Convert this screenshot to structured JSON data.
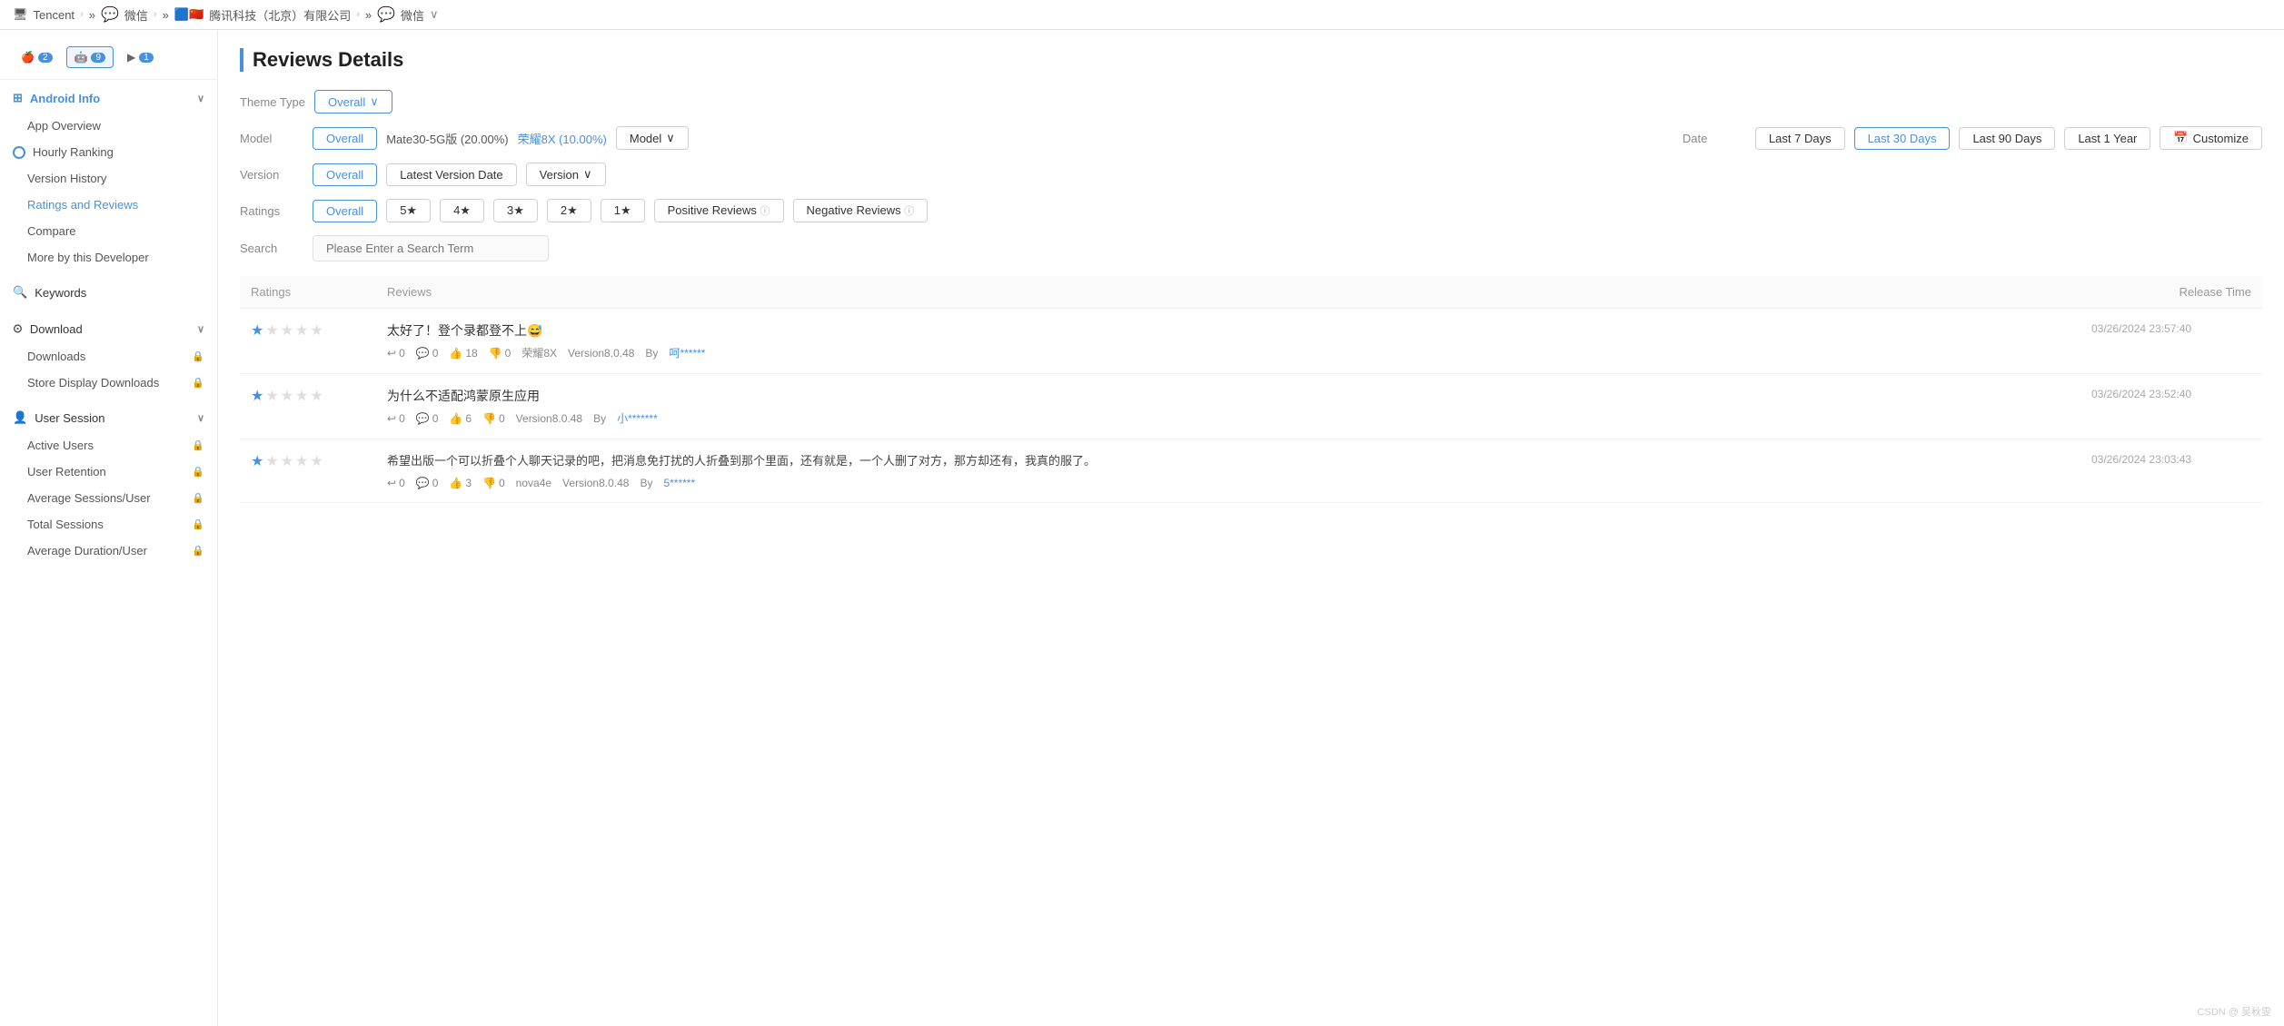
{
  "topbar": {
    "company": "Tencent",
    "app1": "微信",
    "app2": "腾讯科技（北京）有限公司",
    "app3": "微信",
    "chevron": "›",
    "separator": "»"
  },
  "platform_tabs": [
    {
      "id": "ios",
      "icon": "🍎",
      "badge": "2"
    },
    {
      "id": "android",
      "icon": "🤖",
      "badge": "9",
      "active": true
    },
    {
      "id": "play",
      "icon": "▶",
      "badge": "1"
    }
  ],
  "sidebar": {
    "android_info": {
      "label": "Android Info",
      "items": [
        {
          "id": "app-overview",
          "label": "App Overview"
        },
        {
          "id": "hourly-ranking",
          "label": "Hourly Ranking"
        },
        {
          "id": "version-history",
          "label": "Version History"
        },
        {
          "id": "ratings-reviews",
          "label": "Ratings and Reviews",
          "active": true
        },
        {
          "id": "compare",
          "label": "Compare"
        },
        {
          "id": "more-by-developer",
          "label": "More by this Developer"
        }
      ]
    },
    "keywords": {
      "label": "Keywords"
    },
    "download": {
      "label": "Download",
      "items": [
        {
          "id": "downloads",
          "label": "Downloads",
          "lock": true
        },
        {
          "id": "store-display-downloads",
          "label": "Store Display Downloads",
          "lock": true
        }
      ]
    },
    "user_session": {
      "label": "User Session",
      "items": [
        {
          "id": "active-users",
          "label": "Active Users",
          "lock": true
        },
        {
          "id": "user-retention",
          "label": "User Retention",
          "lock": true
        },
        {
          "id": "avg-sessions",
          "label": "Average Sessions/User",
          "lock": true
        },
        {
          "id": "total-sessions",
          "label": "Total Sessions",
          "lock": true
        },
        {
          "id": "avg-duration",
          "label": "Average Duration/User",
          "lock": true
        }
      ]
    }
  },
  "page": {
    "title": "Reviews Details",
    "theme_type_label": "Theme Type",
    "theme_type_value": "Overall",
    "filters": {
      "model_label": "Model",
      "model_options": [
        {
          "id": "overall",
          "label": "Overall",
          "active": true
        },
        {
          "id": "mate30",
          "label": "Mate30-5G版 (20.00%)"
        },
        {
          "id": "huawei8x",
          "label": "荣耀8X (10.00%)",
          "highlighted": true
        }
      ],
      "model_dropdown_label": "Model",
      "date_label": "Date",
      "date_options": [
        {
          "id": "7days",
          "label": "Last 7 Days"
        },
        {
          "id": "30days",
          "label": "Last 30 Days",
          "active": true
        },
        {
          "id": "90days",
          "label": "Last 90 Days"
        },
        {
          "id": "1year",
          "label": "Last 1 Year"
        },
        {
          "id": "customize",
          "label": "Customize"
        }
      ],
      "version_label": "Version",
      "version_options": [
        {
          "id": "overall",
          "label": "Overall",
          "active": true
        },
        {
          "id": "latest",
          "label": "Latest Version Date"
        }
      ],
      "version_dropdown_label": "Version",
      "ratings_label": "Ratings",
      "ratings_options": [
        {
          "id": "overall",
          "label": "Overall",
          "active": true
        },
        {
          "id": "5star",
          "label": "5★"
        },
        {
          "id": "4star",
          "label": "4★"
        },
        {
          "id": "3star",
          "label": "3★"
        },
        {
          "id": "2star",
          "label": "2★"
        },
        {
          "id": "1star",
          "label": "1★"
        },
        {
          "id": "positive",
          "label": "Positive Reviews"
        },
        {
          "id": "negative",
          "label": "Negative Reviews"
        }
      ]
    },
    "search_label": "Search",
    "search_placeholder": "Please Enter a Search Term",
    "table": {
      "columns": [
        "Ratings",
        "Reviews",
        "Release Time"
      ],
      "rows": [
        {
          "stars": 1,
          "total_stars": 5,
          "review_title": "太好了！登个录都登不上😅",
          "reply_count": "0",
          "comment_count": "0",
          "like_count": "18",
          "dislike_count": "0",
          "model": "荣耀8X",
          "version": "Version8.0.48",
          "author": "呵******",
          "author_highlighted": true,
          "release_time": "03/26/2024 23:57:40"
        },
        {
          "stars": 1,
          "total_stars": 5,
          "review_title": "为什么不适配鸿蒙原生应用",
          "reply_count": "0",
          "comment_count": "0",
          "like_count": "6",
          "dislike_count": "0",
          "model": "",
          "version": "Version8.0.48",
          "author": "小*******",
          "author_highlighted": true,
          "release_time": "03/26/2024 23:52:40"
        },
        {
          "stars": 1,
          "total_stars": 5,
          "review_body": "希望出版一个可以折叠个人聊天记录的吧，把消息免打扰的人折叠到那个里面，还有就是，一个人删了对方，那方却还有，我真的服了。",
          "reply_count": "0",
          "comment_count": "0",
          "like_count": "3",
          "dislike_count": "0",
          "model": "nova4e",
          "version": "Version8.0.48",
          "author": "5******",
          "author_highlighted": true,
          "release_time": "03/26/2024 23:03:43"
        }
      ]
    }
  },
  "watermark": "CSDN @ 吴秋雯"
}
